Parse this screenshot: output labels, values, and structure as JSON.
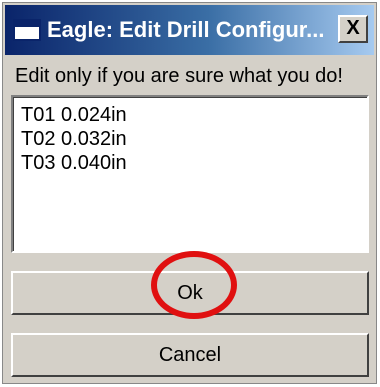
{
  "window": {
    "title": "Eagle: Edit Drill Configur...",
    "close_label": "X"
  },
  "prompt": "Edit only if you are sure what you do!",
  "drills": [
    {
      "label": "T01 0.024in"
    },
    {
      "label": "T02 0.032in"
    },
    {
      "label": "T03 0.040in"
    }
  ],
  "buttons": {
    "ok": "Ok",
    "cancel": "Cancel"
  },
  "annotation": {
    "highlight_color": "#e01010"
  },
  "colors": {
    "titlebar_start": "#0a246a",
    "titlebar_end": "#a6caf0",
    "dialog_bg": "#d4d0c8"
  }
}
